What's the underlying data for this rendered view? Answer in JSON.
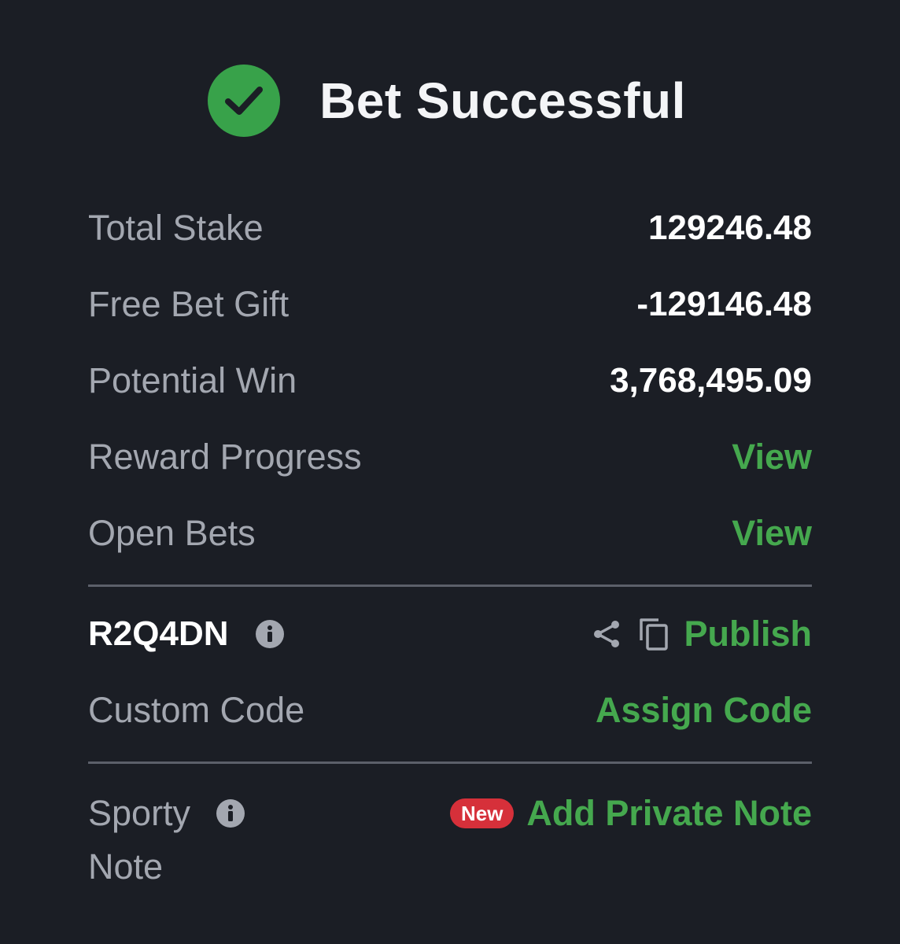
{
  "header": {
    "title": "Bet Successful",
    "icon": "check-circle-icon",
    "accent_color": "#38a24a"
  },
  "summary": {
    "total_stake_label": "Total Stake",
    "total_stake_value": "129246.48",
    "free_bet_label": "Free Bet Gift",
    "free_bet_value": "-129146.48",
    "potential_win_label": "Potential Win",
    "potential_win_value": "3,768,495.09",
    "reward_progress_label": "Reward Progress",
    "reward_progress_link": "View",
    "open_bets_label": "Open Bets",
    "open_bets_link": "View"
  },
  "booking": {
    "code": "R2Q4DN",
    "info_icon": "info-icon",
    "share_icon": "share-icon",
    "copy_icon": "copy-icon",
    "publish_label": "Publish",
    "custom_code_label": "Custom Code",
    "assign_code_label": "Assign Code"
  },
  "note": {
    "label_line1": "Sporty",
    "label_line2": "Note",
    "info_icon": "info-icon",
    "badge": "New",
    "add_note_label": "Add Private Note"
  },
  "colors": {
    "background": "#1b1e25",
    "link": "#45a84e",
    "badge": "#d6303a"
  }
}
